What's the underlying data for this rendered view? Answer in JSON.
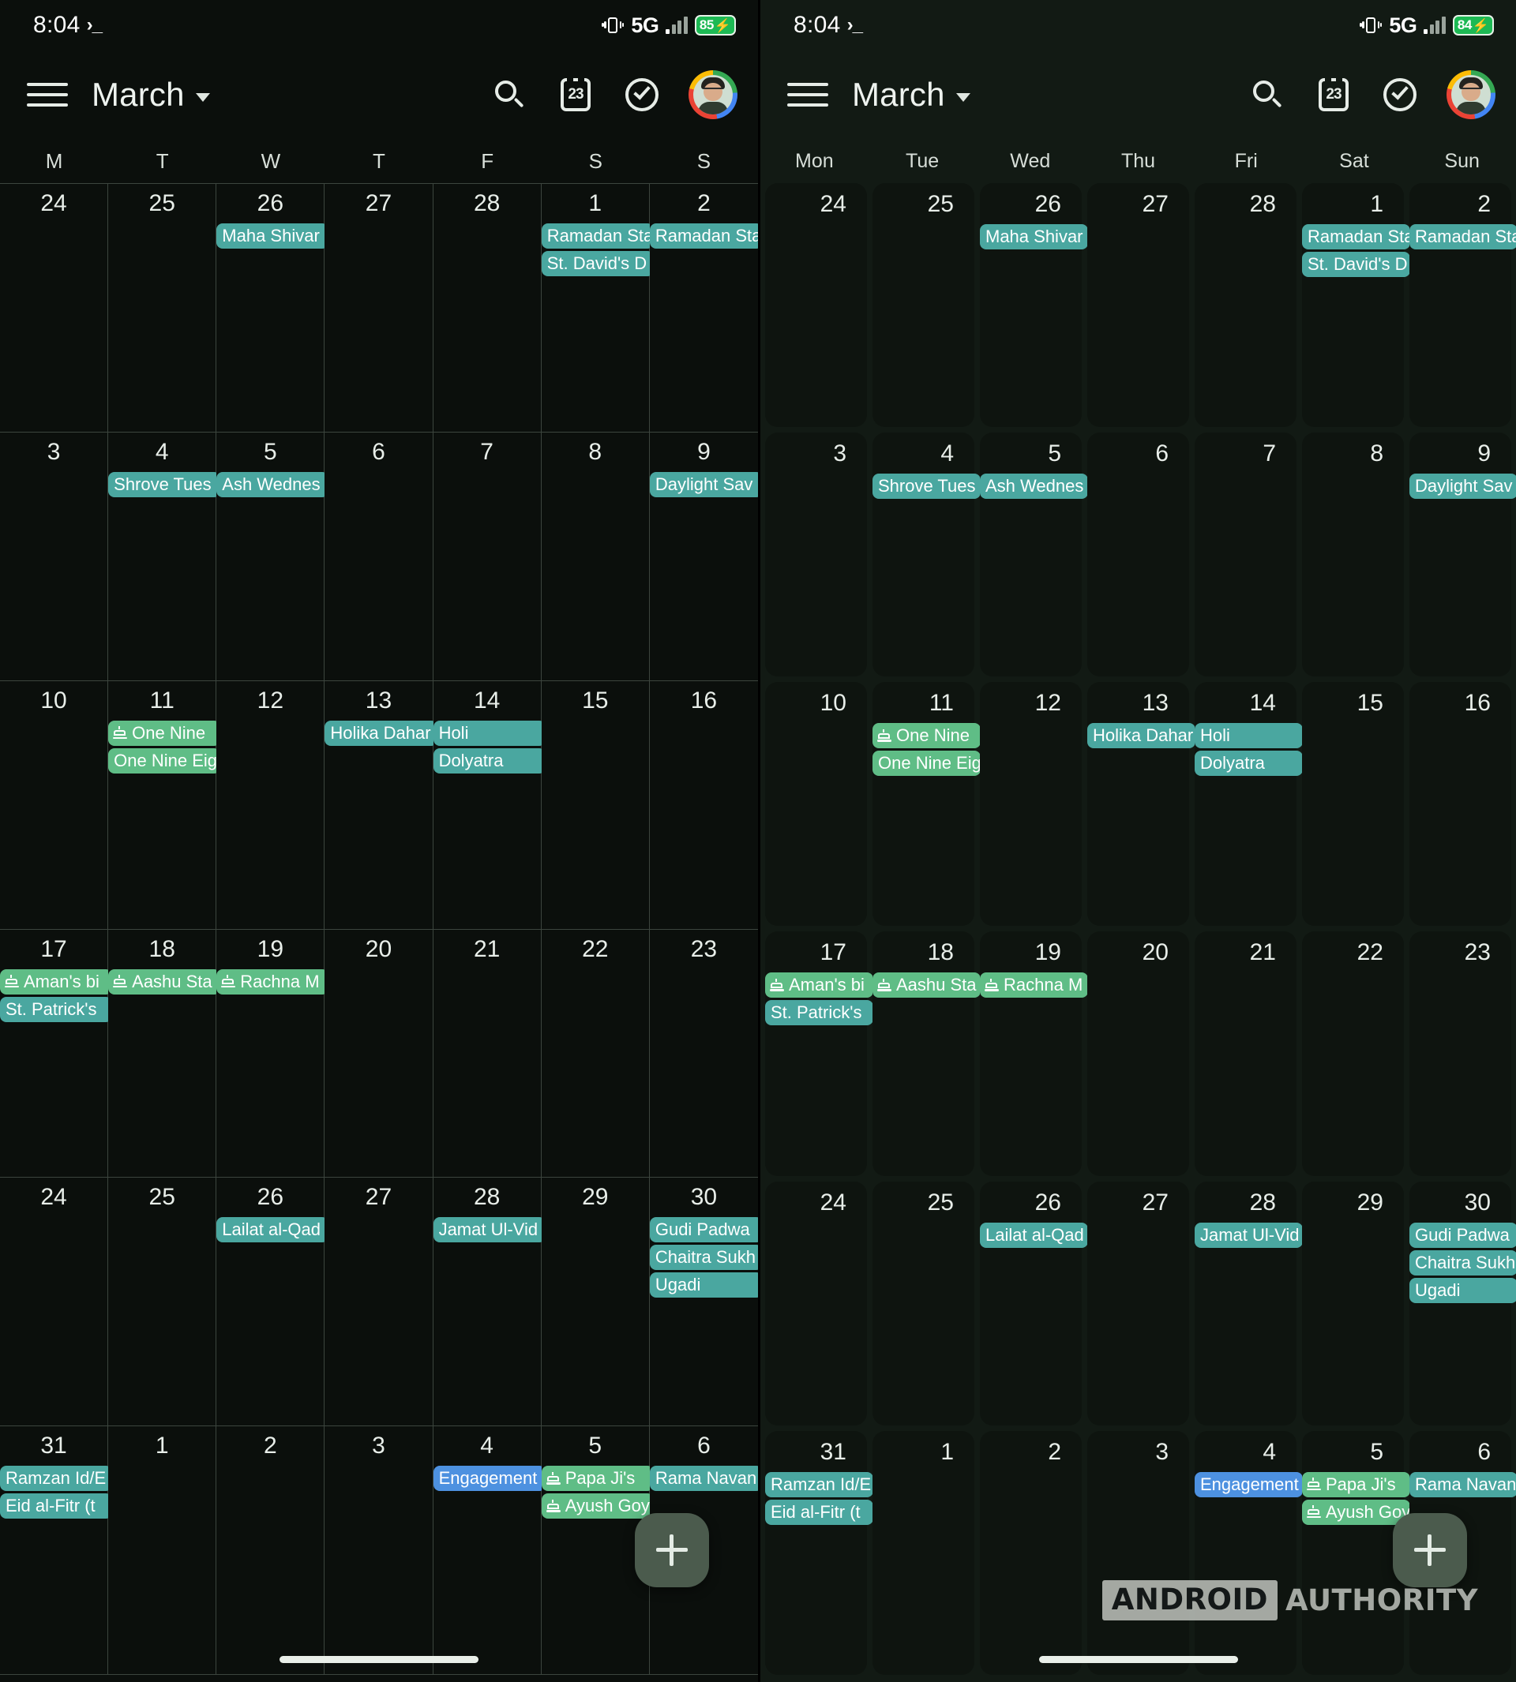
{
  "status_bar": {
    "time": "8:04",
    "terminal_icon": "›_",
    "network": "5G",
    "battery_left": "85",
    "battery_right": "84",
    "bolt": "⚡",
    "icons": [
      "vibrate-icon",
      "signal-icon",
      "battery-icon"
    ]
  },
  "app_bar": {
    "menu_icon": "hamburger-menu-icon",
    "title": "March",
    "caret_icon": "chevron-down-icon",
    "search_icon": "search-icon",
    "today_icon_label": "23",
    "tasks_icon": "check-circle-icon",
    "avatar_label": "account-avatar"
  },
  "weekdays_left": [
    "M",
    "T",
    "W",
    "T",
    "F",
    "S",
    "S"
  ],
  "weekdays_right": [
    "Mon",
    "Tue",
    "Wed",
    "Thu",
    "Fri",
    "Sat",
    "Sun"
  ],
  "fab": {
    "label": "+",
    "name": "create-event-button"
  },
  "watermark": {
    "part_a": "ANDROID",
    "part_b": "AUTHORITY"
  },
  "colors": {
    "chip_teal": "#4aa7a0",
    "chip_green": "#5fbd86",
    "chip_blue": "#4d91e0",
    "panel_left_bg": "#0b0f0c",
    "panel_right_bg": "#121a14",
    "cell_right_bg": "#0e140f",
    "grid_line": "#3c453e",
    "fab_bg": "#4b5b4d",
    "battery_green": "#1db954"
  },
  "calendar": {
    "month": "March",
    "days": [
      {
        "n": "24",
        "events": []
      },
      {
        "n": "25",
        "events": []
      },
      {
        "n": "26",
        "events": [
          {
            "title": "Maha Shivar",
            "color": "teal",
            "birthday": false
          }
        ]
      },
      {
        "n": "27",
        "events": []
      },
      {
        "n": "28",
        "events": []
      },
      {
        "n": "1",
        "events": [
          {
            "title": "Ramadan Sta",
            "color": "teal",
            "birthday": false
          },
          {
            "title": "St. David's D",
            "color": "teal",
            "birthday": false
          }
        ]
      },
      {
        "n": "2",
        "events": [
          {
            "title": "Ramadan Sta",
            "color": "teal",
            "birthday": false
          }
        ]
      },
      {
        "n": "3",
        "events": []
      },
      {
        "n": "4",
        "events": [
          {
            "title": "Shrove Tues",
            "color": "teal",
            "birthday": false
          }
        ]
      },
      {
        "n": "5",
        "events": [
          {
            "title": "Ash Wednes",
            "color": "teal",
            "birthday": false
          }
        ]
      },
      {
        "n": "6",
        "events": []
      },
      {
        "n": "7",
        "events": []
      },
      {
        "n": "8",
        "events": []
      },
      {
        "n": "9",
        "events": [
          {
            "title": "Daylight Sav",
            "color": "teal",
            "birthday": false
          }
        ]
      },
      {
        "n": "10",
        "events": []
      },
      {
        "n": "11",
        "events": [
          {
            "title": "One Nine",
            "color": "green",
            "birthday": true
          },
          {
            "title": "One Nine Eig",
            "color": "green",
            "birthday": false
          }
        ]
      },
      {
        "n": "12",
        "events": []
      },
      {
        "n": "13",
        "events": [
          {
            "title": "Holika Dahar",
            "color": "teal",
            "birthday": false
          }
        ]
      },
      {
        "n": "14",
        "events": [
          {
            "title": "Holi",
            "color": "teal",
            "birthday": false
          },
          {
            "title": "Dolyatra",
            "color": "teal",
            "birthday": false
          }
        ]
      },
      {
        "n": "15",
        "events": []
      },
      {
        "n": "16",
        "events": []
      },
      {
        "n": "17",
        "events": [
          {
            "title": "Aman's bi",
            "color": "green",
            "birthday": true
          },
          {
            "title": "St. Patrick's",
            "color": "teal",
            "birthday": false
          }
        ]
      },
      {
        "n": "18",
        "events": [
          {
            "title": "Aashu Sta",
            "color": "green",
            "birthday": true
          }
        ]
      },
      {
        "n": "19",
        "events": [
          {
            "title": "Rachna M",
            "color": "green",
            "birthday": true
          }
        ]
      },
      {
        "n": "20",
        "events": []
      },
      {
        "n": "21",
        "events": []
      },
      {
        "n": "22",
        "events": []
      },
      {
        "n": "23",
        "events": []
      },
      {
        "n": "24",
        "events": []
      },
      {
        "n": "25",
        "events": []
      },
      {
        "n": "26",
        "events": [
          {
            "title": "Lailat al-Qad",
            "color": "teal",
            "birthday": false
          }
        ]
      },
      {
        "n": "27",
        "events": []
      },
      {
        "n": "28",
        "events": [
          {
            "title": "Jamat Ul-Vid",
            "color": "teal",
            "birthday": false
          }
        ]
      },
      {
        "n": "29",
        "events": []
      },
      {
        "n": "30",
        "events": [
          {
            "title": "Gudi Padwa",
            "color": "teal",
            "birthday": false
          },
          {
            "title": "Chaitra Sukh",
            "color": "teal",
            "birthday": false
          },
          {
            "title": "Ugadi",
            "color": "teal",
            "birthday": false
          }
        ]
      },
      {
        "n": "31",
        "events": [
          {
            "title": "Ramzan Id/E",
            "color": "teal",
            "birthday": false
          },
          {
            "title": "Eid al-Fitr (t",
            "color": "teal",
            "birthday": false
          }
        ]
      },
      {
        "n": "1",
        "events": []
      },
      {
        "n": "2",
        "events": []
      },
      {
        "n": "3",
        "events": []
      },
      {
        "n": "4",
        "events": [
          {
            "title": "Engagement",
            "color": "blue",
            "birthday": false
          }
        ]
      },
      {
        "n": "5",
        "events": [
          {
            "title": "Papa Ji's",
            "color": "green",
            "birthday": true
          },
          {
            "title": "Ayush Goy",
            "color": "green",
            "birthday": true
          }
        ]
      },
      {
        "n": "6",
        "events": [
          {
            "title": "Rama Navan",
            "color": "teal",
            "birthday": false
          }
        ]
      }
    ]
  }
}
